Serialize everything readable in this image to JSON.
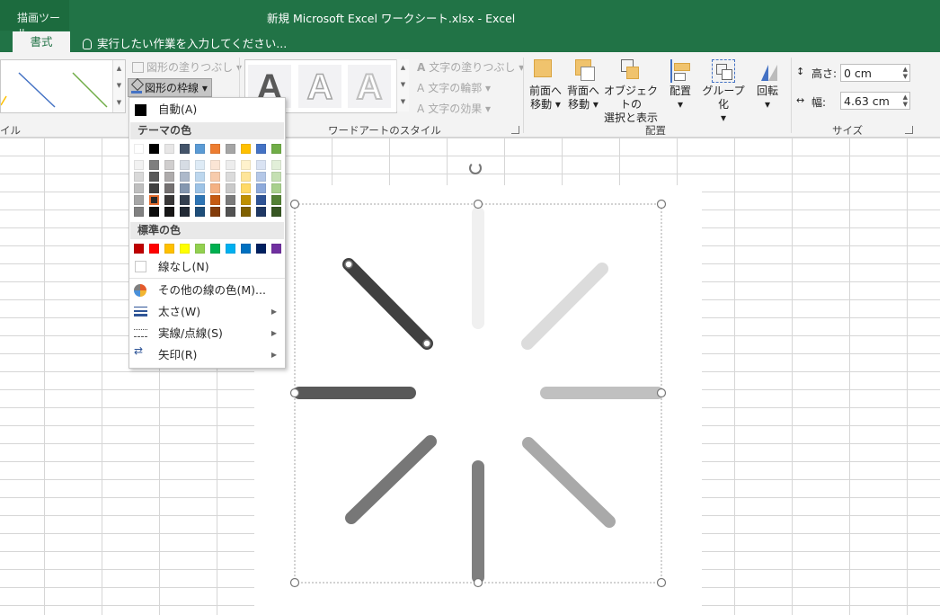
{
  "titlebar": {
    "context_group": "描画ツール",
    "window_title": "新規 Microsoft Excel ワークシート.xlsx - Excel",
    "active_tab": "書式",
    "tell_me": "実行したい作業を入力してください..."
  },
  "ribbon": {
    "shape_styles": {
      "fill_label": "図形の塗りつぶし",
      "outline_label": "図形の枠線",
      "group_label_partial": "イル"
    },
    "wordart": {
      "text_fill": "文字の塗りつぶし",
      "text_outline": "文字の輪郭",
      "text_effects": "文字の効果",
      "group_label": "ワードアートのスタイル",
      "tile_letter": "A"
    },
    "arrange": {
      "bring_forward": [
        "前面へ",
        "移動"
      ],
      "send_backward": [
        "背面へ",
        "移動"
      ],
      "selection_pane": [
        "オブジェクトの",
        "選択と表示"
      ],
      "align": "配置",
      "group": "グループ化",
      "rotate": "回転",
      "group_label": "配置"
    },
    "size": {
      "height_label": "高さ:",
      "height_value": "0 cm",
      "width_label": "幅:",
      "width_value": "4.63 cm",
      "group_label": "サイズ"
    }
  },
  "dropdown": {
    "automatic": "自動(A)",
    "theme_colors_header": "テーマの色",
    "standard_colors_header": "標準の色",
    "no_line": "線なし(N)",
    "more_colors": "その他の線の色(M)...",
    "weight": "太さ(W)",
    "dashes": "実線/点線(S)",
    "arrows": "矢印(R)",
    "theme_top_row": [
      "#ffffff",
      "#000000",
      "#e7e6e6",
      "#44546a",
      "#5b9bd5",
      "#ed7d31",
      "#a5a5a5",
      "#ffc000",
      "#4472c4",
      "#70ad47"
    ],
    "theme_shades": [
      [
        "#f2f2f2",
        "#d9d9d9",
        "#bfbfbf",
        "#a6a6a6",
        "#808080"
      ],
      [
        "#7f7f7f",
        "#595959",
        "#3f3f3f",
        "#262626",
        "#0d0d0d"
      ],
      [
        "#d0cece",
        "#aeabab",
        "#757171",
        "#3a3838",
        "#171616"
      ],
      [
        "#d6dce4",
        "#adb9ca",
        "#8497b0",
        "#333f4f",
        "#222a35"
      ],
      [
        "#deebf6",
        "#bdd7ee",
        "#9dc3e6",
        "#2e75b5",
        "#1e4e79"
      ],
      [
        "#fbe5d5",
        "#f7cbac",
        "#f4b183",
        "#c55a11",
        "#833c0b"
      ],
      [
        "#ededed",
        "#dbdbdb",
        "#c9c9c9",
        "#7b7b7b",
        "#525252"
      ],
      [
        "#fff2cc",
        "#fee599",
        "#ffd965",
        "#bf9000",
        "#7f6000"
      ],
      [
        "#dae3f3",
        "#b4c7e7",
        "#8eaadb",
        "#2f5496",
        "#1f3864"
      ],
      [
        "#e2efd9",
        "#c5e0b3",
        "#a8d08d",
        "#538135",
        "#375623"
      ]
    ],
    "selected_swatch": "theme-1-shade-3",
    "standard": [
      "#c00000",
      "#ff0000",
      "#ffc000",
      "#ffff00",
      "#92d050",
      "#00b050",
      "#00b0f0",
      "#0070c0",
      "#002060",
      "#7030a0"
    ]
  }
}
